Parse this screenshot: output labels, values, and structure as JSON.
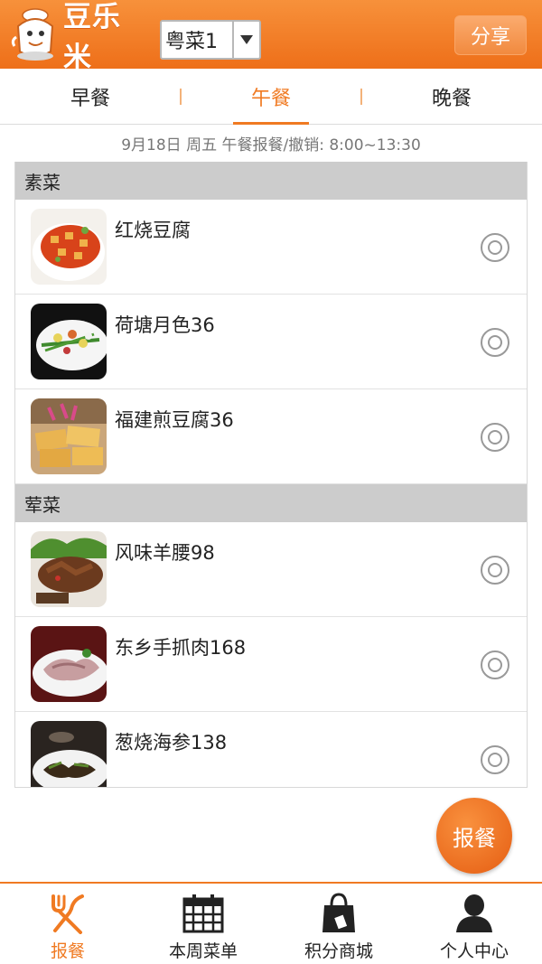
{
  "header": {
    "logo_text": "豆乐米",
    "cuisine_selected": "粤菜1",
    "share_label": "分享"
  },
  "tabs": [
    {
      "label": "早餐",
      "active": false
    },
    {
      "label": "午餐",
      "active": true
    },
    {
      "label": "晚餐",
      "active": false
    }
  ],
  "date_info": "9月18日 周五   午餐报餐/撤销: 8:00~13:30",
  "menu": {
    "categories": [
      {
        "name": "素菜",
        "dishes": [
          {
            "name": "红烧豆腐",
            "thumb": "mapo-tofu"
          },
          {
            "name": "荷塘月色36",
            "thumb": "lotus-veg"
          },
          {
            "name": "福建煎豆腐36",
            "thumb": "fried-tofu"
          }
        ]
      },
      {
        "name": "荤菜",
        "dishes": [
          {
            "name": "风味羊腰98",
            "thumb": "lamb-kidney"
          },
          {
            "name": "东乡手抓肉168",
            "thumb": "hand-meat"
          },
          {
            "name": "葱烧海参138",
            "thumb": "sea-cucumber"
          }
        ]
      }
    ]
  },
  "order_button_label": "报餐",
  "bottom_nav": [
    {
      "label": "报餐",
      "icon": "fork-knife-icon",
      "active": true
    },
    {
      "label": "本周菜单",
      "icon": "calendar-icon",
      "active": false
    },
    {
      "label": "积分商城",
      "icon": "shopping-bag-icon",
      "active": false
    },
    {
      "label": "个人中心",
      "icon": "person-icon",
      "active": false
    }
  ],
  "colors": {
    "brand_orange": "#f07a22",
    "header_gradient_top": "#f7913b",
    "header_gradient_bottom": "#ee6f19",
    "category_bg": "#cccccc"
  }
}
